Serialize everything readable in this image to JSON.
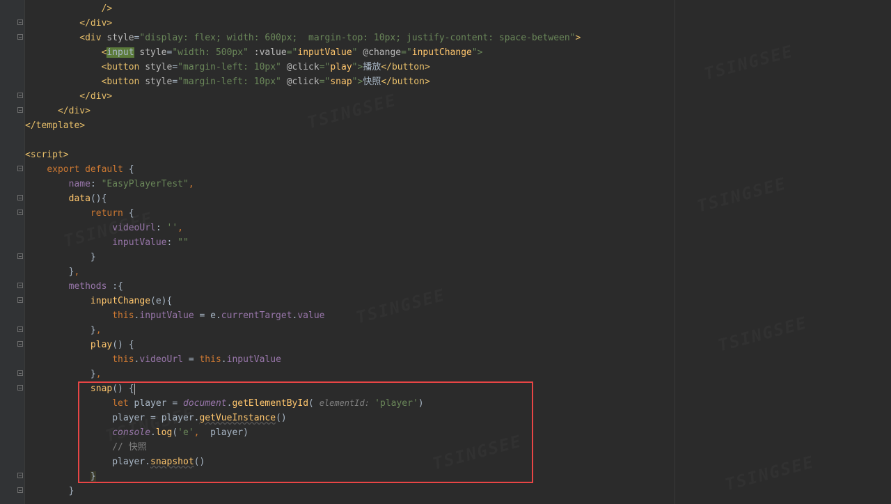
{
  "code": {
    "l0": "              />",
    "l1_a": "          </",
    "l1_b": "div",
    "l1_c": ">",
    "l2_a": "          <",
    "l2_b": "div ",
    "l2_c": "style",
    "l2_d": "=",
    "l2_e": "\"display: flex; width: 600px;  margin-top: 10px; justify-content: space-between\"",
    "l2_f": ">",
    "l3_a": "              <",
    "l3_b": "input",
    "l3_c": " ",
    "l3_d": "style",
    "l3_e": "=",
    "l3_f": "\"width: 500px\" ",
    "l3_g": ":value",
    "l3_h": "=\"",
    "l3_i": "inputValue",
    "l3_j": "\" ",
    "l3_k": "@change",
    "l3_l": "=\"",
    "l3_m": "inputChange",
    "l3_n": "\">",
    "l4_a": "              <",
    "l4_b": "button ",
    "l4_c": "style",
    "l4_d": "=",
    "l4_e": "\"margin-left: 10px\" ",
    "l4_f": "@click",
    "l4_g": "=\"",
    "l4_h": "play",
    "l4_i": "\">",
    "l4_j": "播放",
    "l4_k": "</",
    "l4_l": "button",
    "l4_m": ">",
    "l5_a": "              <",
    "l5_b": "button ",
    "l5_c": "style",
    "l5_d": "=",
    "l5_e": "\"margin-left: 10px\" ",
    "l5_f": "@click",
    "l5_g": "=\"",
    "l5_h": "snap",
    "l5_i": "\">",
    "l5_j": "快照",
    "l5_k": "</",
    "l5_l": "button",
    "l5_m": ">",
    "l6_a": "          </",
    "l6_b": "div",
    "l6_c": ">",
    "l7_a": "      </",
    "l7_b": "div",
    "l7_c": ">",
    "l8_a": "</",
    "l8_b": "template",
    "l8_c": ">",
    "l10_a": "<",
    "l10_b": "script",
    "l10_c": ">",
    "l11_a": "    ",
    "l11_b": "export default ",
    "l11_c": "{",
    "l12_a": "        ",
    "l12_b": "name",
    "l12_c": ": ",
    "l12_d": "\"EasyPlayerTest\"",
    "l12_e": ",",
    "l13_a": "        ",
    "l13_b": "data",
    "l13_c": "(){",
    "l14_a": "            ",
    "l14_b": "return ",
    "l14_c": "{",
    "l15_a": "                ",
    "l15_b": "videoUrl",
    "l15_c": ": ",
    "l15_d": "''",
    "l15_e": ",",
    "l16_a": "                ",
    "l16_b": "inputValue",
    "l16_c": ": ",
    "l16_d": "\"\"",
    "l17_a": "            }",
    "l18_a": "        }",
    "l18_b": ",",
    "l19_a": "        ",
    "l19_b": "methods ",
    "l19_c": ":{",
    "l20_a": "            ",
    "l20_b": "inputChange",
    "l20_c": "(",
    "l20_d": "e",
    "l20_e": "){",
    "l21_a": "                ",
    "l21_b": "this",
    "l21_c": ".",
    "l21_d": "inputValue ",
    "l21_e": "= ",
    "l21_f": "e",
    "l21_g": ".",
    "l21_h": "currentTarget",
    "l21_i": ".",
    "l21_j": "value",
    "l22_a": "            }",
    "l22_b": ",",
    "l23_a": "            ",
    "l23_b": "play",
    "l23_c": "() {",
    "l24_a": "                ",
    "l24_b": "this",
    "l24_c": ".",
    "l24_d": "videoUrl ",
    "l24_e": "= ",
    "l24_f": "this",
    "l24_g": ".",
    "l24_h": "inputValue",
    "l25_a": "            }",
    "l25_b": ",",
    "l26_a": "            ",
    "l26_b": "snap",
    "l26_c": "() ",
    "l26_d": "{",
    "l27_a": "                ",
    "l27_b": "let ",
    "l27_c": "player ",
    "l27_d": "= ",
    "l27_e": "document",
    "l27_f": ".",
    "l27_g": "getElementById",
    "l27_h": "( ",
    "l27_i": "elementId: ",
    "l27_j": "'player'",
    "l27_k": ")",
    "l28_a": "                ",
    "l28_b": "player ",
    "l28_c": "= ",
    "l28_d": "player",
    "l28_e": ".",
    "l28_f": "getVueInstance",
    "l28_g": "()",
    "l29_a": "                ",
    "l29_b": "console",
    "l29_c": ".",
    "l29_d": "log",
    "l29_e": "(",
    "l29_f": "'e'",
    "l29_g": ",  ",
    "l29_h": "player",
    "l29_i": ")",
    "l30_a": "                ",
    "l30_b": "// 快照",
    "l31_a": "                ",
    "l31_b": "player",
    "l31_c": ".",
    "l31_d": "snapshot",
    "l31_e": "()",
    "l32_a": "            ",
    "l32_b": "}",
    "l33_a": "        }"
  },
  "watermark_text": "TSINGSEE"
}
